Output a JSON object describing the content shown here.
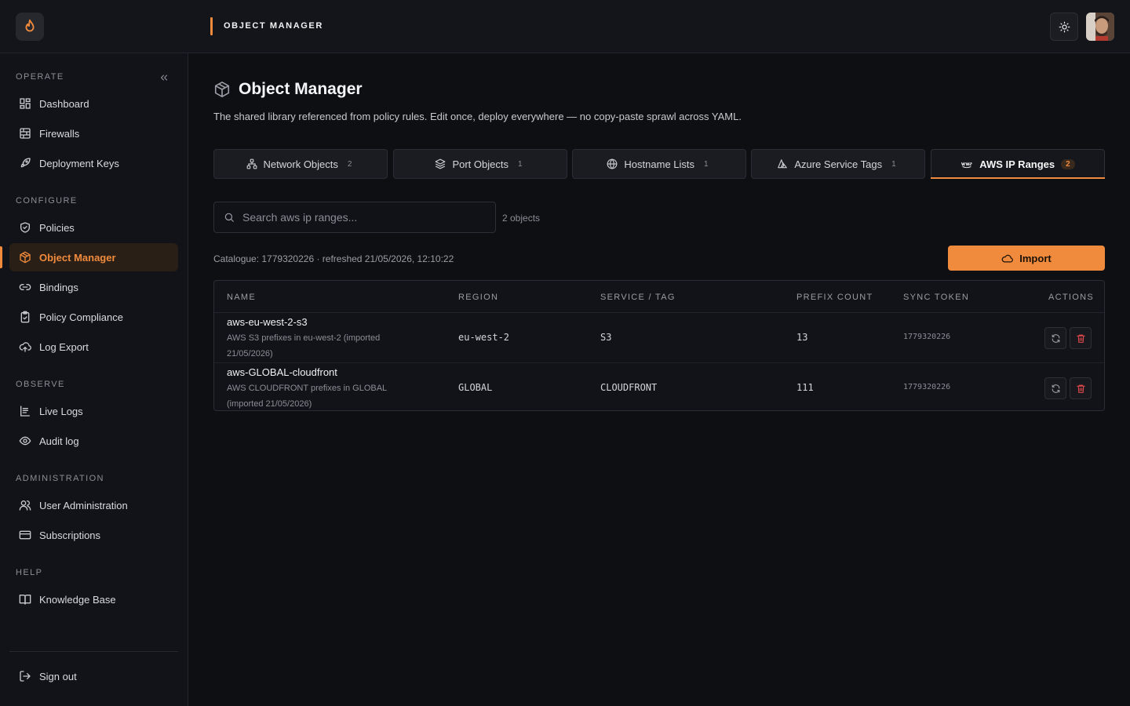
{
  "header": {
    "title": "OBJECT MANAGER"
  },
  "sidebar": {
    "sections": [
      {
        "label": "OPERATE",
        "items": [
          {
            "label": "Dashboard",
            "icon": "dashboard-icon"
          },
          {
            "label": "Firewalls",
            "icon": "firewall-icon"
          },
          {
            "label": "Deployment Keys",
            "icon": "rocket-icon"
          }
        ]
      },
      {
        "label": "CONFIGURE",
        "items": [
          {
            "label": "Policies",
            "icon": "shield-icon"
          },
          {
            "label": "Object Manager",
            "icon": "box-icon",
            "active": true
          },
          {
            "label": "Bindings",
            "icon": "link-icon"
          },
          {
            "label": "Policy Compliance",
            "icon": "clipboard-check-icon"
          },
          {
            "label": "Log Export",
            "icon": "cloud-upload-icon"
          }
        ]
      },
      {
        "label": "OBSERVE",
        "items": [
          {
            "label": "Live Logs",
            "icon": "logs-icon"
          },
          {
            "label": "Audit log",
            "icon": "eye-icon"
          }
        ]
      },
      {
        "label": "ADMINISTRATION",
        "items": [
          {
            "label": "User Administration",
            "icon": "users-icon"
          },
          {
            "label": "Subscriptions",
            "icon": "card-icon"
          }
        ]
      },
      {
        "label": "HELP",
        "items": [
          {
            "label": "Knowledge Base",
            "icon": "book-icon"
          }
        ]
      }
    ],
    "sign_out": "Sign out"
  },
  "page": {
    "title": "Object Manager",
    "description": "The shared library referenced from policy rules. Edit once, deploy everywhere — no copy-paste sprawl across YAML."
  },
  "tabs": [
    {
      "label": "Network Objects",
      "count": "2",
      "icon": "network-icon"
    },
    {
      "label": "Port Objects",
      "count": "1",
      "icon": "layers-icon"
    },
    {
      "label": "Hostname Lists",
      "count": "1",
      "icon": "globe-icon"
    },
    {
      "label": "Azure Service Tags",
      "count": "1",
      "icon": "azure-icon"
    },
    {
      "label": "AWS IP Ranges",
      "count": "2",
      "icon": "aws-icon",
      "active": true
    }
  ],
  "search": {
    "placeholder": "Search aws ip ranges...",
    "count_text": "2 objects"
  },
  "catalogue_text": "Catalogue: 1779320226 · refreshed 21/05/2026, 12:10:22",
  "import_label": "Import",
  "table": {
    "columns": [
      "NAME",
      "REGION",
      "SERVICE / TAG",
      "PREFIX COUNT",
      "SYNC TOKEN",
      "ACTIONS"
    ],
    "rows": [
      {
        "name": "aws-eu-west-2-s3",
        "description": "AWS S3 prefixes in eu-west-2 (imported 21/05/2026)",
        "region": "eu-west-2",
        "service": "S3",
        "prefix_count": "13",
        "sync_token": "1779320226"
      },
      {
        "name": "aws-GLOBAL-cloudfront",
        "description": "AWS CLOUDFRONT prefixes in GLOBAL (imported 21/05/2026)",
        "region": "GLOBAL",
        "service": "CLOUDFRONT",
        "prefix_count": "111",
        "sync_token": "1779320226"
      }
    ]
  },
  "colors": {
    "accent": "#f08a3c",
    "background": "#0e0f13",
    "danger": "#e5484d"
  }
}
